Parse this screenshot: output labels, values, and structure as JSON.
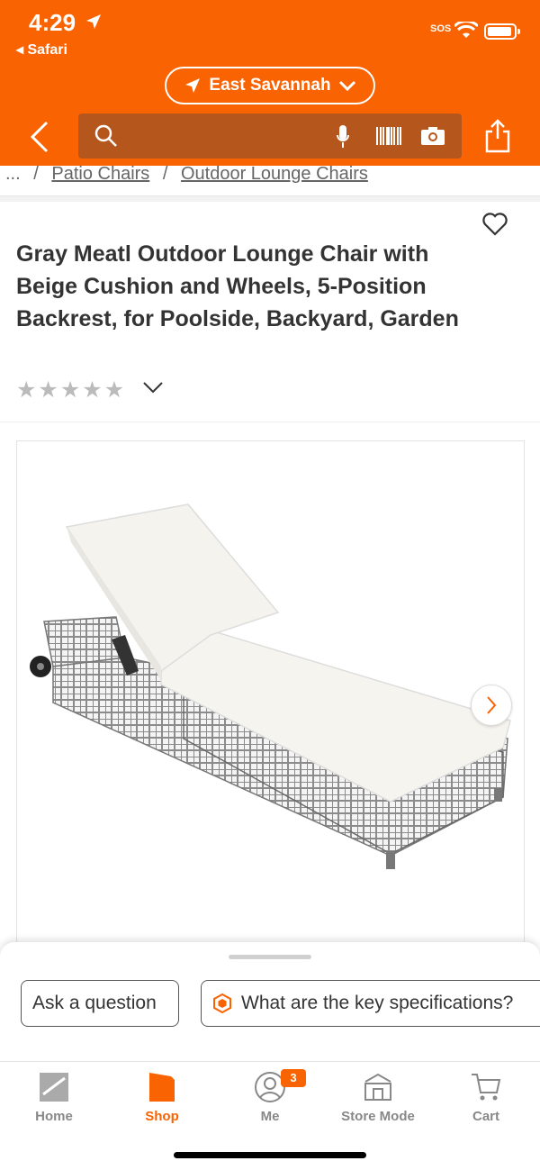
{
  "status_bar": {
    "time": "4:29",
    "back_app": "◂ Safari",
    "sos": "SOS"
  },
  "store": {
    "label": "East Savannah"
  },
  "search": {
    "placeholder": ""
  },
  "breadcrumb": {
    "ellipsis": "...",
    "items": [
      "Patio Chairs",
      "Outdoor Lounge Chairs"
    ]
  },
  "product": {
    "title": "Gray Meatl Outdoor Lounge Chair with Beige Cushion and Wheels, 5-Position Backrest, for Poolside, Backyard, Garden",
    "rating": 0,
    "max_rating": 5
  },
  "chips": {
    "ask": "Ask a question",
    "spec": "What are the key specifications?"
  },
  "tabs": [
    {
      "label": "Home",
      "icon": "home-depot-logo-icon"
    },
    {
      "label": "Shop",
      "icon": "shop-icon"
    },
    {
      "label": "Me",
      "icon": "user-icon"
    },
    {
      "label": "Store Mode",
      "icon": "store-icon"
    },
    {
      "label": "Cart",
      "icon": "cart-icon"
    }
  ],
  "me_badge": "3",
  "colors": {
    "brand": "#f96302",
    "search_bg": "#b5561c"
  }
}
